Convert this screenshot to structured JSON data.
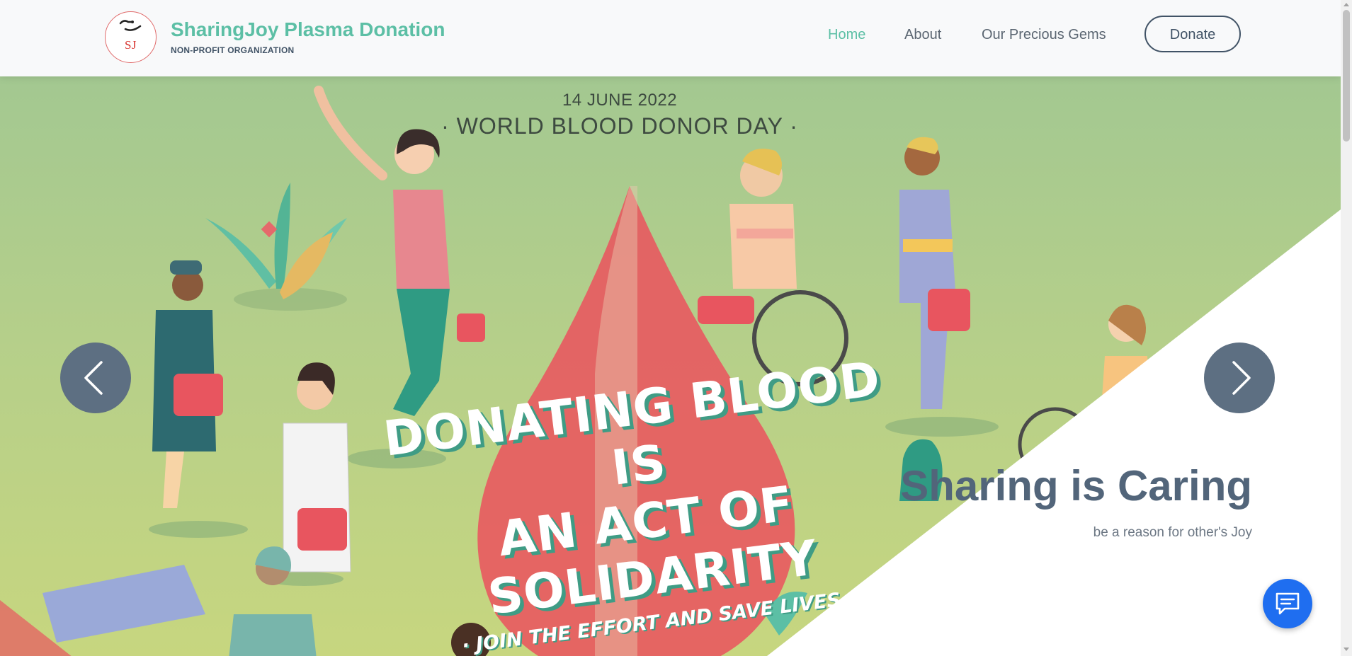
{
  "brand": {
    "logo_text": "SJ",
    "name": "SharingJoy Plasma Donation",
    "tagline": "NON-PROFIT ORGANIZATION"
  },
  "nav": {
    "links": [
      "Home",
      "About",
      "Our Precious Gems"
    ],
    "active": "Home",
    "donate_label": "Donate"
  },
  "hero": {
    "date": "14 JUNE 2022",
    "title": "· WORLD BLOOD DONOR DAY ·",
    "slogan_line1": "DONATING BLOOD IS",
    "slogan_line2": "AN ACT OF SOLIDARITY",
    "slogan_line3": "· JOIN THE EFFORT AND SAVE LIVES ·",
    "caption_title": "Sharing is Caring",
    "caption_subtitle": "be a reason for other's Joy"
  },
  "icons": {
    "prev": "chevron-left-icon",
    "next": "chevron-right-icon",
    "chat": "chat-icon"
  },
  "colors": {
    "accent": "#5cbfa5",
    "navy": "#415366",
    "chat": "#1f6ef0",
    "drop": "#e9555f"
  }
}
